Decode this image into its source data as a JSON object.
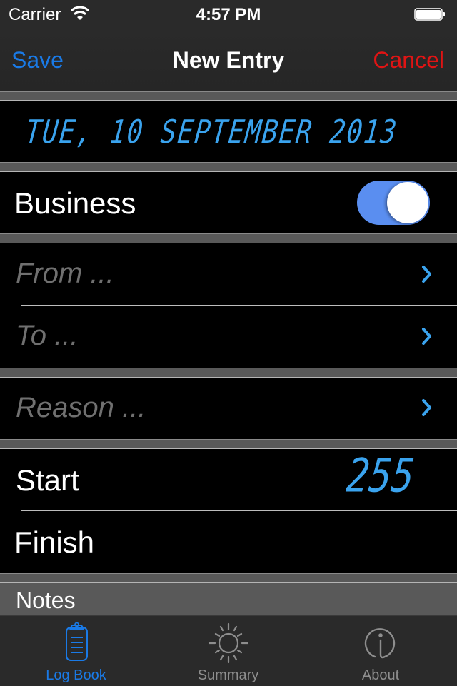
{
  "status_bar": {
    "carrier": "Carrier",
    "time": "4:57 PM",
    "wifi_icon": "wifi-icon",
    "battery_icon": "battery-icon"
  },
  "nav_bar": {
    "title": "New Entry",
    "save_label": "Save",
    "cancel_label": "Cancel"
  },
  "date": {
    "value": "TUE, 10 SEPTEMBER 2013"
  },
  "business": {
    "label": "Business",
    "enabled": true
  },
  "route": {
    "from_placeholder": "From ...",
    "to_placeholder": "To ..."
  },
  "reason": {
    "placeholder": "Reason ..."
  },
  "odometer": {
    "start_label": "Start",
    "start_value": "255",
    "finish_label": "Finish",
    "finish_value": ""
  },
  "notes": {
    "header": "Notes"
  },
  "tab_bar": {
    "items": [
      {
        "label": "Log Book",
        "icon": "clipboard-icon",
        "active": true
      },
      {
        "label": "Summary",
        "icon": "sun-icon",
        "active": false
      },
      {
        "label": "About",
        "icon": "info-icon",
        "active": false
      }
    ]
  },
  "colors": {
    "accent_blue": "#1a7ae6",
    "cancel_red": "#e01414",
    "lcd_blue": "#3aa3ee",
    "toggle_on": "#5a8ef0",
    "tab_inactive": "#8e8e8e"
  }
}
